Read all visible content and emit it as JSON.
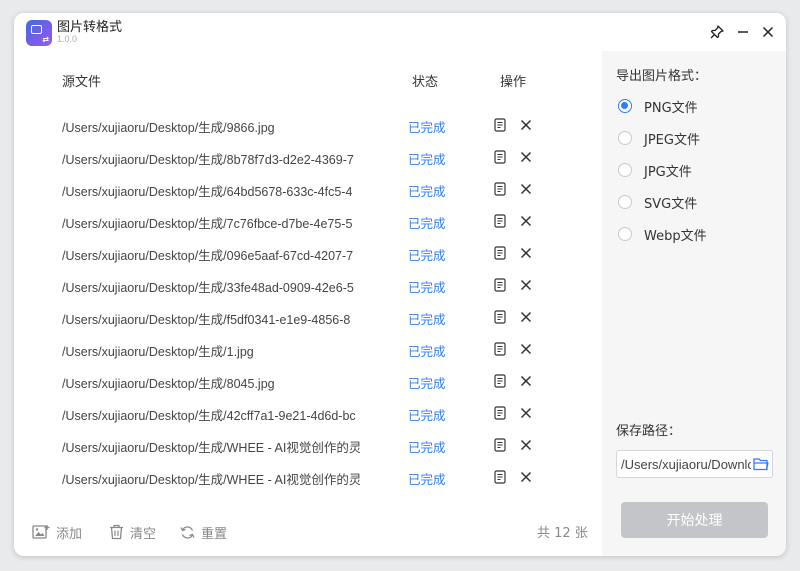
{
  "app": {
    "title": "图片转格式",
    "version": "1.0.0"
  },
  "table": {
    "headers": {
      "file": "源文件",
      "status": "状态",
      "actions": "操作"
    },
    "rows": [
      {
        "path": "/Users/xujiaoru/Desktop/生成/9866.jpg",
        "status": "已完成"
      },
      {
        "path": "/Users/xujiaoru/Desktop/生成/8b78f7d3-d2e2-4369-7",
        "status": "已完成"
      },
      {
        "path": "/Users/xujiaoru/Desktop/生成/64bd5678-633c-4fc5-4",
        "status": "已完成"
      },
      {
        "path": "/Users/xujiaoru/Desktop/生成/7c76fbce-d7be-4e75-5",
        "status": "已完成"
      },
      {
        "path": "/Users/xujiaoru/Desktop/生成/096e5aaf-67cd-4207-7",
        "status": "已完成"
      },
      {
        "path": "/Users/xujiaoru/Desktop/生成/33fe48ad-0909-42e6-5",
        "status": "已完成"
      },
      {
        "path": "/Users/xujiaoru/Desktop/生成/f5df0341-e1e9-4856-8",
        "status": "已完成"
      },
      {
        "path": "/Users/xujiaoru/Desktop/生成/1.jpg",
        "status": "已完成"
      },
      {
        "path": "/Users/xujiaoru/Desktop/生成/8045.jpg",
        "status": "已完成"
      },
      {
        "path": "/Users/xujiaoru/Desktop/生成/42cff7a1-9e21-4d6d-bc",
        "status": "已完成"
      },
      {
        "path": "/Users/xujiaoru/Desktop/生成/WHEE - AI视觉创作的灵",
        "status": "已完成"
      },
      {
        "path": "/Users/xujiaoru/Desktop/生成/WHEE - AI视觉创作的灵",
        "status": "已完成"
      }
    ]
  },
  "footer": {
    "add_label": "添加",
    "clear_label": "清空",
    "reset_label": "重置",
    "count_text": "共 12 张"
  },
  "sidebar": {
    "format_title": "导出图片格式：",
    "formats": [
      "PNG文件",
      "JPEG文件",
      "JPG文件",
      "SVG文件",
      "Webp文件"
    ],
    "selected_format": "PNG文件",
    "save_path_title": "保存路径：",
    "save_path_value": "/Users/xujiaoru/Downloads",
    "start_label": "开始处理"
  },
  "colors": {
    "accent": "#2f7cf6",
    "status_done": "#2f7cf6",
    "start_button_disabled": "#c3c5c9",
    "sidebar_bg": "#f6f6f7"
  },
  "icons": {
    "app": "image-convert-icon",
    "pin": "pin-icon",
    "minimize": "minimize-icon",
    "close": "close-icon",
    "row_detail": "document-icon",
    "row_delete": "delete-x-icon",
    "add": "add-image-icon",
    "clear": "trash-icon",
    "reset": "refresh-icon",
    "browse": "folder-icon"
  }
}
